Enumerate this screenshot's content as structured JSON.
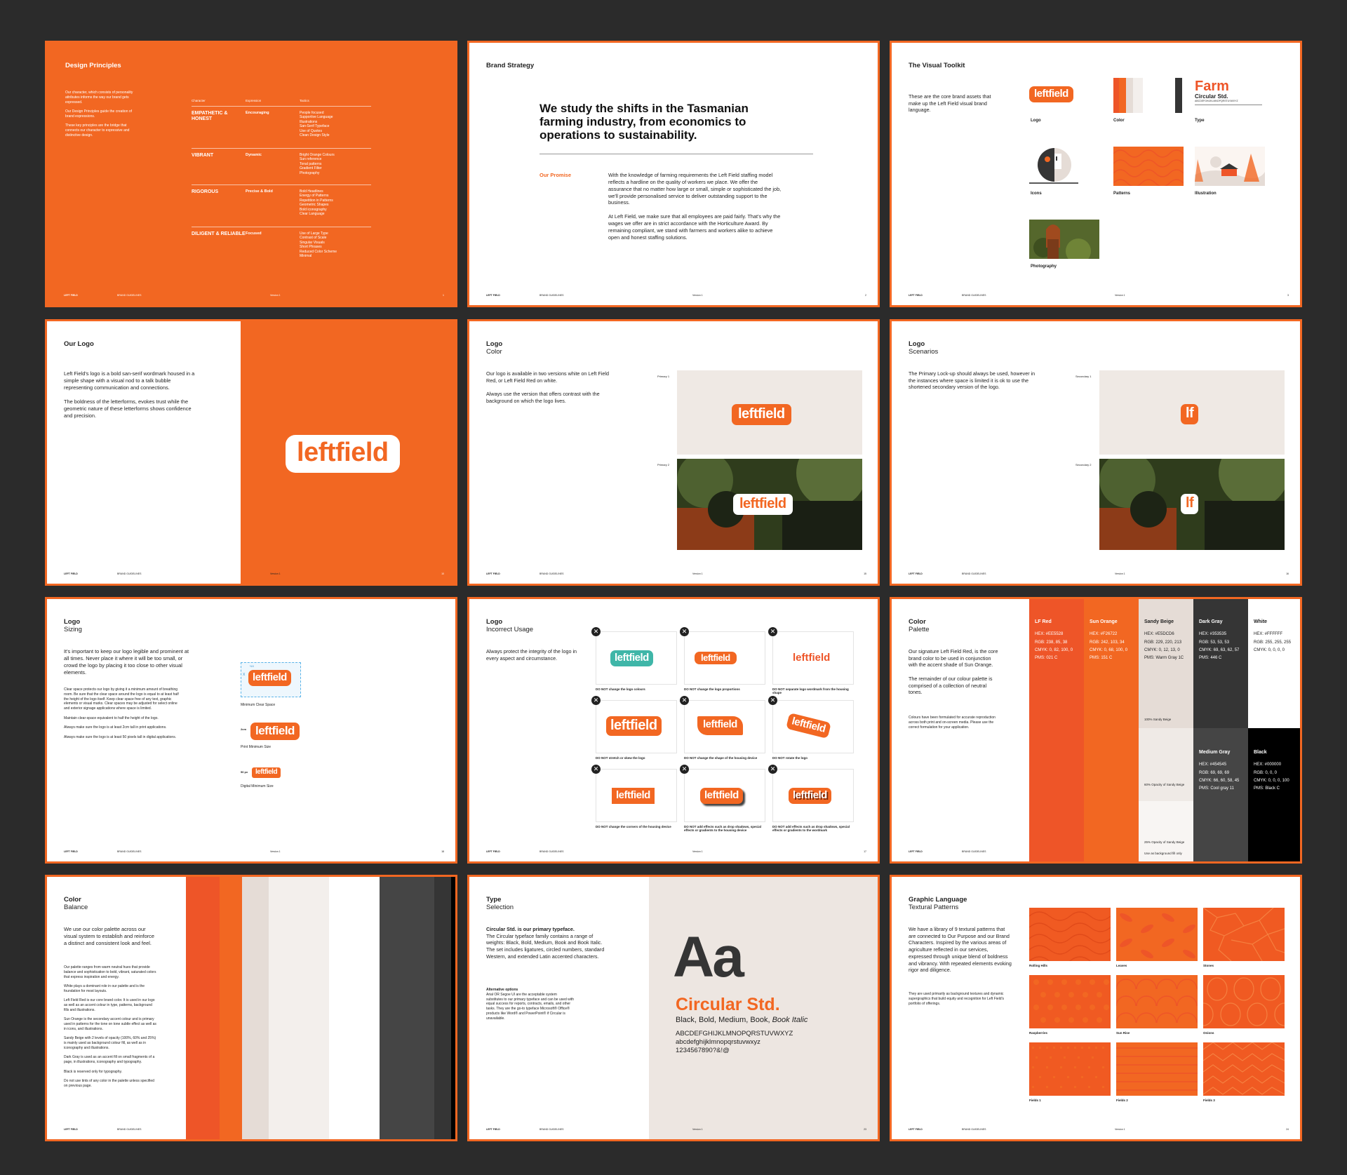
{
  "footer": {
    "brand": "LEFT FIELD",
    "doc": "BRAND GUIDELINES",
    "version": "Version 1"
  },
  "colors": {
    "lf_red": "#EE5528",
    "sun_orange": "#F26722",
    "sandy_beige": "#E5DCD6",
    "dark_gray": "#353535",
    "medium_gray": "#454545",
    "black": "#000000",
    "white": "#FFFFFF"
  },
  "p1": {
    "title": "Design Principles",
    "intro1": "Our character, which consists of personality attributes informs the way our brand gets expressed.",
    "intro2": "Our Design Principles guide the creation of brand expressions.",
    "intro3": "These key principles are the bridge that connects our character to expressive and distinctive design.",
    "headers": [
      "Character",
      "Expression",
      "Tactics"
    ],
    "rows": [
      {
        "c": "EMPATHETIC & HONEST",
        "e": "Encouraging",
        "t": "People focused\nSupportive Language\nIllustrations\nSan-Serif Typeface\nUse of Quotes\nClean Design Style"
      },
      {
        "c": "VIBRANT",
        "e": "Dynamic",
        "t": "Bright Orange Colours\nSun reference\nTonal patterns\nGradient Filter\nPhotography"
      },
      {
        "c": "RIGOROUS",
        "e": "Precise & Bold",
        "t": "Bold Headlines\nEnergy of Patterns\nRepetition in Patterns\nGeometric Shapes\nBold iconography\nClear Language"
      },
      {
        "c": "DILIGENT & RELIABLE",
        "e": "Focused",
        "t": "Use of Large Type\nContrast of Scale\nSingular Visuals\nShort Phrases\nReduced Color Scheme\nMinimal"
      }
    ],
    "page": "1"
  },
  "p2": {
    "title": "Brand Strategy",
    "headline": "We study the shifts in the Tasmanian farming industry, from economics to operations to sustainability.",
    "promise_label": "Our Promise",
    "body1": "With the knowledge of farming requirements the Left Field staffing model reflects a hardline on the quality of workers we place. We offer the assurance that no matter how large or small, simple or sophisticated the job, we'll provide personalised service to deliver outstanding support to the business.",
    "body2": "At Left Field, we make sure that all employees are paid fairly. That's why the wages we offer are in strict accordance with the Horticulture Award. By remaining compliant, we stand with farmers and workers alike to achieve open and honest staffing solutions.",
    "page": "2"
  },
  "p3": {
    "title": "The Visual Toolkit",
    "intro": "These are the core brand assets that make up the Left Field visual brand language.",
    "logo_word": "leftfield",
    "type_big": "Farm",
    "type_name": "Circular Std.",
    "type_alpha": "ABCDEFGHIJKLMNOPQRSTUVWXYZ",
    "items": [
      "Logo",
      "Color",
      "Type",
      "Icons",
      "Patterns",
      "Illustration",
      "Photography"
    ],
    "page": "3"
  },
  "p4": {
    "title": "Our Logo",
    "body1": "Left Field's logo is a bold san-serif wordmark housed in a simple shape with a visual nod to a talk bubble representing communication and connections.",
    "body2": "The boldness of the letterforms, evokes trust while the geometric nature of these letterforms shows confidence and precision.",
    "logo_word": "leftfield",
    "page": "10"
  },
  "p5": {
    "title": "Logo",
    "subtitle": "Color",
    "body1": "Our logo is available in two versions white on Left Field Red, or Left Field Red on white.",
    "body2": "Always use the version that offers contrast with the background on which the logo lives.",
    "label1": "Primary 1",
    "label2": "Primary 2",
    "logo_word": "leftfield",
    "page": "15"
  },
  "p6": {
    "title": "Logo",
    "subtitle": "Scenarios",
    "body": "The Primary Lock-up should always be used, however in the instances where space is limited it is ok to use the shortened secondary version of the logo.",
    "label1": "Secondary 1",
    "label2": "Secondary 2",
    "short_word": "lf",
    "page": "16"
  },
  "p7": {
    "title": "Logo",
    "subtitle": "Sizing",
    "body": "It's important to keep our logo legible and prominent at all times. Never place it where it will be too small, or crowd the logo by placing it too close to other visual elements.",
    "small1": "Clear space protects our logo by giving it a minimum amount of breathing room. Be sure that the clear space around the logo is equal to at least half the height of the logo itself. Keep clear space free of any text, graphic elements or visual marks. Clear spaces may be adjusted for select online and exterior signage applications where space is limited.",
    "small2": "Maintain clear-space equivalent to half the height of the logo.",
    "small3": "Always make sure the logo is at least 2cm tall in print applications.",
    "small4": "Always make sure the logo is at least 50 pixels tall in digital applications.",
    "cap1": "Minimum Clear Space",
    "cap2": "Print Minimum Size",
    "cap3": "Digital Minimum Size",
    "dim1": "2cm",
    "dim2": "50 px",
    "mark_x": "X",
    "mark_half": "½X",
    "logo_word": "leftfield",
    "page": "18"
  },
  "p8": {
    "title": "Logo",
    "subtitle": "Incorrect Usage",
    "body": "Always protect the integrity of the logo in every aspect and circumstance.",
    "logo_word": "leftfield",
    "x_mark": "✕",
    "captions": [
      "DO NOT change the logo colours",
      "DO NOT change the logo proportions",
      "DO NOT separate logo wordmark from the housing shape",
      "DO NOT stretch or skew the logo",
      "DO NOT change the shape of the housing device",
      "DO NOT rotate the logo",
      "DO NOT change the corners of the housing device",
      "DO NOT add effects such as drop shadows, special effects or gradients to the housing device",
      "DO NOT add effects such as drop shadows, special effects or gradients to the wordmark"
    ],
    "page": "17"
  },
  "p9": {
    "title": "Color",
    "subtitle": "Palette",
    "body1": "Our signature Left Field Red, is the core brand color to be used in conjunction with the accent shade of Sun Orange.",
    "body2": "The remainder of our colour palette is comprised of a collection of neutral tones.",
    "small": "Colours have been formulated for accurate reproduction across both print and on-screen media. Please use the correct formulation for your application.",
    "swatches": [
      {
        "name": "LF Red",
        "lines": [
          "HEX: #EE5528",
          "RGB: 238, 85, 38",
          "CMYK: 0, 82, 100, 0",
          "PMS: 021 C"
        ]
      },
      {
        "name": "Sun Orange",
        "lines": [
          "HEX: #F26722",
          "RGB: 242, 103, 34",
          "CMYK: 0, 68, 100, 0",
          "PMS: 151 C"
        ]
      },
      {
        "name": "Sandy Beige",
        "lines": [
          "HEX: #E5DCD6",
          "RGB: 229, 220, 213",
          "CMYK: 0, 12, 13, 0",
          "PMS: Warm Gray 1C"
        ]
      },
      {
        "name": "Dark Gray",
        "lines": [
          "HEX: #353535",
          "RGB: 53, 53, 53",
          "CMYK: 69, 63, 62, 57",
          "PMS: 446 C"
        ]
      },
      {
        "name": "White",
        "lines": [
          "HEX: #FFFFFF",
          "RGB: 255, 255, 255",
          "CMYK: 0, 0, 0, 0"
        ]
      },
      {
        "name": "Medium Gray",
        "lines": [
          "HEX: #454545",
          "RGB: 69, 69, 69",
          "CMYK: 66, 60, 58, 45",
          "PMS: Cool gray 11"
        ]
      },
      {
        "name": "Black",
        "lines": [
          "HEX: #000000",
          "RGB: 0, 0, 0",
          "CMYK: 0, 0, 0, 100",
          "PMS: Black C"
        ]
      }
    ],
    "beige1": "100% Sandy Beige",
    "beige2": "60% Opacity of Sandy Beige",
    "beige3": "25% Opacity of Sandy Beige",
    "beige3b": "Use as background fill only",
    "page": "21"
  },
  "p10": {
    "title": "Color",
    "subtitle": "Balance",
    "body": "We use our color palette across our visual system to establish and reinforce a distinct and consistent look and feel.",
    "smalls": [
      "Our palette ranges from warm neutral hues that provide balance and sophistication to bold, vibrant, saturated colors that express inspiration and energy.",
      "White plays a dominant role in our palette and is the foundation for most layouts.",
      "Left Field Red is our core brand color. It is used in our logo as well as an accent colour in type, patterns, background fills and illustrations.",
      "Sun Orange is the secondary accent colour and is primary used in patterns for the tone on tone subtle effect as well as in icons, and illustrations.",
      "Sandy Beige with 2 levels of opacity (100%, 60% and 25%) is mainly used as background colour fill, as well as in iconography and illustrations.",
      "Dark Gray is used as an accent fill on small fragments of a page, in illustrations, iconography and typography.",
      "Black is reserved only for typography.",
      "Do not use tints of any color in the palette unless specified on previous page."
    ],
    "page": "22"
  },
  "p11": {
    "title": "Type",
    "subtitle": "Selection",
    "lead": "Circular Std. is our primary typeface.",
    "body": "The Circular typeface family contains a range of weights: Black, Bold, Medium, Book and Book Italic. The set includes ligatures, circled numbers, standard Western, and extended Latin accented characters.",
    "alt_title": "Alternative options",
    "alt_body": "Arial OR Segoe UI are the acceptable system substitutes to our primary typeface and can be used with equal success for reports, contracts, emails, and other tasks. They are the go-to typeface Microsoft® Office® products like Word® and PowerPoint® if Circular is unavailable.",
    "specimen": "Aa",
    "name": "Circular Std.",
    "weights": "Black, Bold, Medium, Book,",
    "weights_italic": "Book Italic",
    "upper": "ABCDEFGHIJKLMNOPQRSTUVWXYZ",
    "lower": "abcdefghijklmnopqrstuvwxyz",
    "nums": "1234567890?&!@",
    "page": "23"
  },
  "p12": {
    "title": "Graphic Language",
    "subtitle": "Textural Patterns",
    "body": "We have a library of 9 textural patterns that are connected to Our Purpose and our Brand Characters. Inspired by the various areas of agriculture reflected in our services, expressed through unique blend of boldness and vibrancy. With repeated elements evoking rigor and diligence.",
    "small": "They are used primarily as background textures and dynamic supergraphics that build equity and recognition for Left Field's portfolio of offerings.",
    "patterns": [
      "Rolling Hills",
      "Leaves",
      "Stones",
      "Raspberries",
      "Sun Rise",
      "Onions",
      "Fields 1",
      "Fields 2",
      "Fields 3"
    ],
    "page": "24"
  }
}
